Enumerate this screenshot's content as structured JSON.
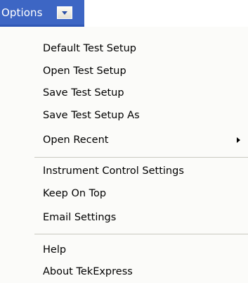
{
  "menu_bar": {
    "options_label": "Options"
  },
  "menu": {
    "items": [
      {
        "label": "Default Test Setup"
      },
      {
        "label": "Open Test Setup"
      },
      {
        "label": "Save Test Setup"
      },
      {
        "label": "Save Test Setup As"
      },
      {
        "label": "Open Recent"
      },
      {
        "label": "Instrument Control Settings"
      },
      {
        "label": "Keep On Top"
      },
      {
        "label": "Email Settings"
      },
      {
        "label": "Help"
      },
      {
        "label": "About TekExpress"
      }
    ]
  },
  "colors": {
    "menu_bar_bg": "#3d66c4",
    "menu_bg": "#fbfbf9",
    "separator": "#c9c9c0",
    "text": "#000000"
  },
  "icons": {
    "dropdown": "chevron-down-icon",
    "submenu": "submenu-arrow-icon"
  }
}
